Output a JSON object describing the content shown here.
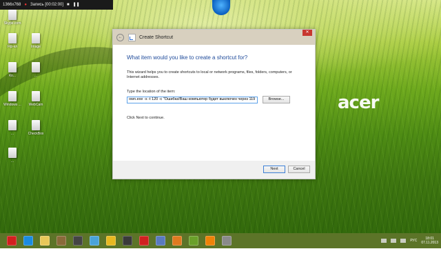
{
  "recorder": {
    "resolution": "1366x768",
    "recording_label": "Запись [00:02:00]"
  },
  "desktop_icons": [
    {
      "label": "Skype.com"
    },
    {
      "label": "Ftp-кл"
    },
    {
      "label": "Image"
    },
    {
      "label": "Ко..."
    },
    {
      "label": "..."
    },
    {
      "label": "Windows ..."
    },
    {
      "label": "WebCam"
    },
    {
      "label": "..."
    },
    {
      "label": "CheckBox"
    },
    {
      "label": "..."
    }
  ],
  "brand": "acer",
  "dialog": {
    "title": "Create Shortcut",
    "close": "✕",
    "heading": "What item would you like to create a shortcut for?",
    "description": "This wizard helps you to create shortcuts to local or network programs, files, folders, computers, or Internet addresses.",
    "location_label": "Type the location of the item:",
    "location_value": "own.exe -s -t 120 -c \"Ошибка!Ваш компьютер будет выключен через 119",
    "browse_label": "Browse...",
    "hint": "Click Next to continue.",
    "next_label": "Next",
    "cancel_label": "Cancel"
  },
  "taskbar": {
    "icons": [
      {
        "name": "opera-icon",
        "color": "#d21f1f"
      },
      {
        "name": "ie-icon",
        "color": "#1b8be0"
      },
      {
        "name": "explorer-icon",
        "color": "#e8c85a"
      },
      {
        "name": "app-icon",
        "color": "#8a6a3a"
      },
      {
        "name": "camera-icon",
        "color": "#444444"
      },
      {
        "name": "media-icon",
        "color": "#4aa3d8"
      },
      {
        "name": "chrome-icon",
        "color": "#e8b820"
      },
      {
        "name": "torrent-icon",
        "color": "#3a3a3a"
      },
      {
        "name": "yandex-icon",
        "color": "#d02020"
      },
      {
        "name": "audio-icon",
        "color": "#5a7abf"
      },
      {
        "name": "mail-icon",
        "color": "#e07a20"
      },
      {
        "name": "game-icon",
        "color": "#6aa02a"
      },
      {
        "name": "odnoklassniki-icon",
        "color": "#ee8208"
      },
      {
        "name": "settings-icon",
        "color": "#8a8a8a"
      }
    ],
    "language": "РУС",
    "time": "18:01",
    "date": "07.11.2013"
  }
}
